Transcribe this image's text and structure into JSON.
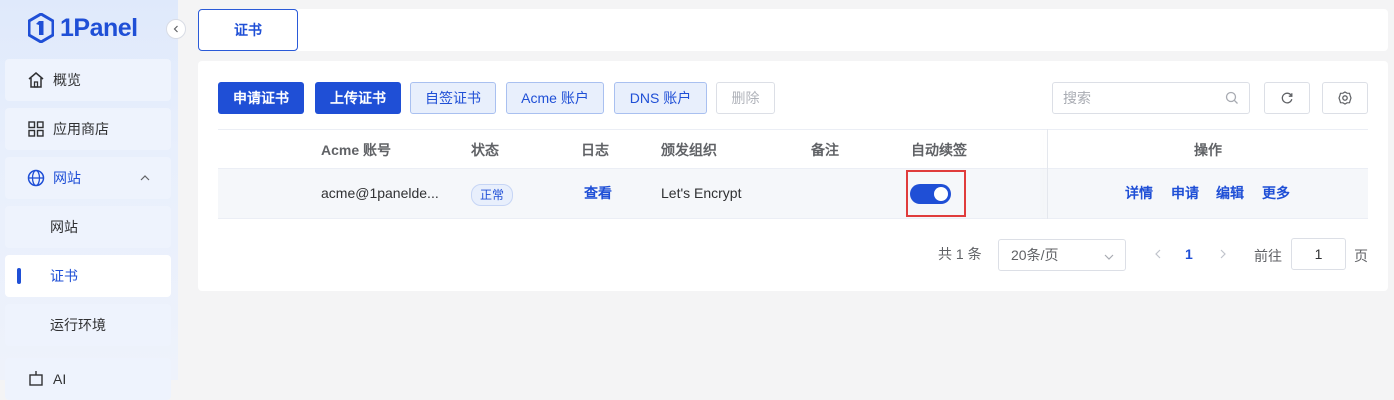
{
  "brand": {
    "name": "1Panel",
    "color": "#1f4fd6"
  },
  "sidebar": {
    "items": [
      {
        "label": "概览",
        "icon": "home-icon"
      },
      {
        "label": "应用商店",
        "icon": "grid-icon"
      },
      {
        "label": "网站",
        "icon": "globe-icon",
        "expanded": true
      },
      {
        "label": "网站",
        "sub": true
      },
      {
        "label": "证书",
        "sub": true,
        "active": true
      },
      {
        "label": "运行环境",
        "sub": true
      },
      {
        "label": "AI",
        "icon": "ai-icon"
      }
    ]
  },
  "tabs": [
    {
      "label": "证书",
      "active": true
    }
  ],
  "toolbar": {
    "apply_cert": "申请证书",
    "upload_cert": "上传证书",
    "self_signed": "自签证书",
    "acme_account": "Acme 账户",
    "dns_account": "DNS 账户",
    "delete": "删除",
    "search_placeholder": "搜索"
  },
  "table": {
    "columns": [
      "Acme 账号",
      "状态",
      "日志",
      "颁发组织",
      "备注",
      "自动续签",
      "操作"
    ],
    "rows": [
      {
        "acme_account": "acme@1panelde...",
        "status": "正常",
        "log": "查看",
        "issuer": "Let's Encrypt",
        "remark": "",
        "auto_renew": true,
        "actions": [
          "详情",
          "申请",
          "编辑",
          "更多"
        ]
      }
    ]
  },
  "pagination": {
    "total_text": "共 1 条",
    "page_size": "20条/页",
    "current_page": "1",
    "goto_label": "前往",
    "goto_value": "1",
    "page_suffix": "页"
  }
}
